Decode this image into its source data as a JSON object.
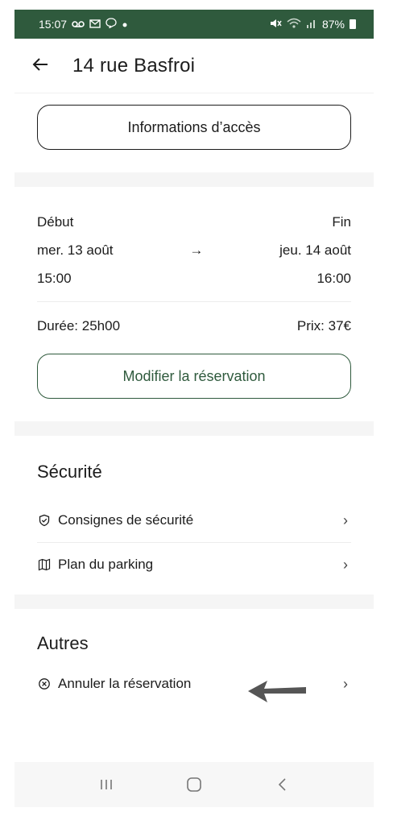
{
  "status_bar": {
    "time": "15:07",
    "left_icons": [
      "voicemail-icon",
      "gmail-icon",
      "chat-icon",
      "dot-icon"
    ],
    "right_icons": [
      "mute-icon",
      "wifi-icon",
      "signal-icon",
      "battery-icon"
    ],
    "battery": "87%"
  },
  "header": {
    "title": "14 rue Basfroi"
  },
  "access": {
    "button_label": "Informations d’accès"
  },
  "booking": {
    "start_label": "Début",
    "end_label": "Fin",
    "start_date": "mer. 13 août",
    "end_date": "jeu. 14 août",
    "arrow": "→",
    "start_time": "15:00",
    "end_time": "16:00",
    "duration": "Durée: 25h00",
    "price": "Prix: 37€",
    "modify_label": "Modifier la réservation",
    "accent_color": "#2f5a3d"
  },
  "security": {
    "title": "Sécurité",
    "items": [
      {
        "label": "Consignes de sécurité",
        "icon": "shield-check-icon"
      },
      {
        "label": "Plan du parking",
        "icon": "map-icon"
      }
    ]
  },
  "others": {
    "title": "Autres",
    "items": [
      {
        "label": "Annuler la réservation",
        "icon": "cancel-circle-icon"
      }
    ]
  },
  "nav": {
    "recent_icon": "recent-apps-icon",
    "home_icon": "home-icon",
    "back_icon": "nav-back-icon"
  }
}
